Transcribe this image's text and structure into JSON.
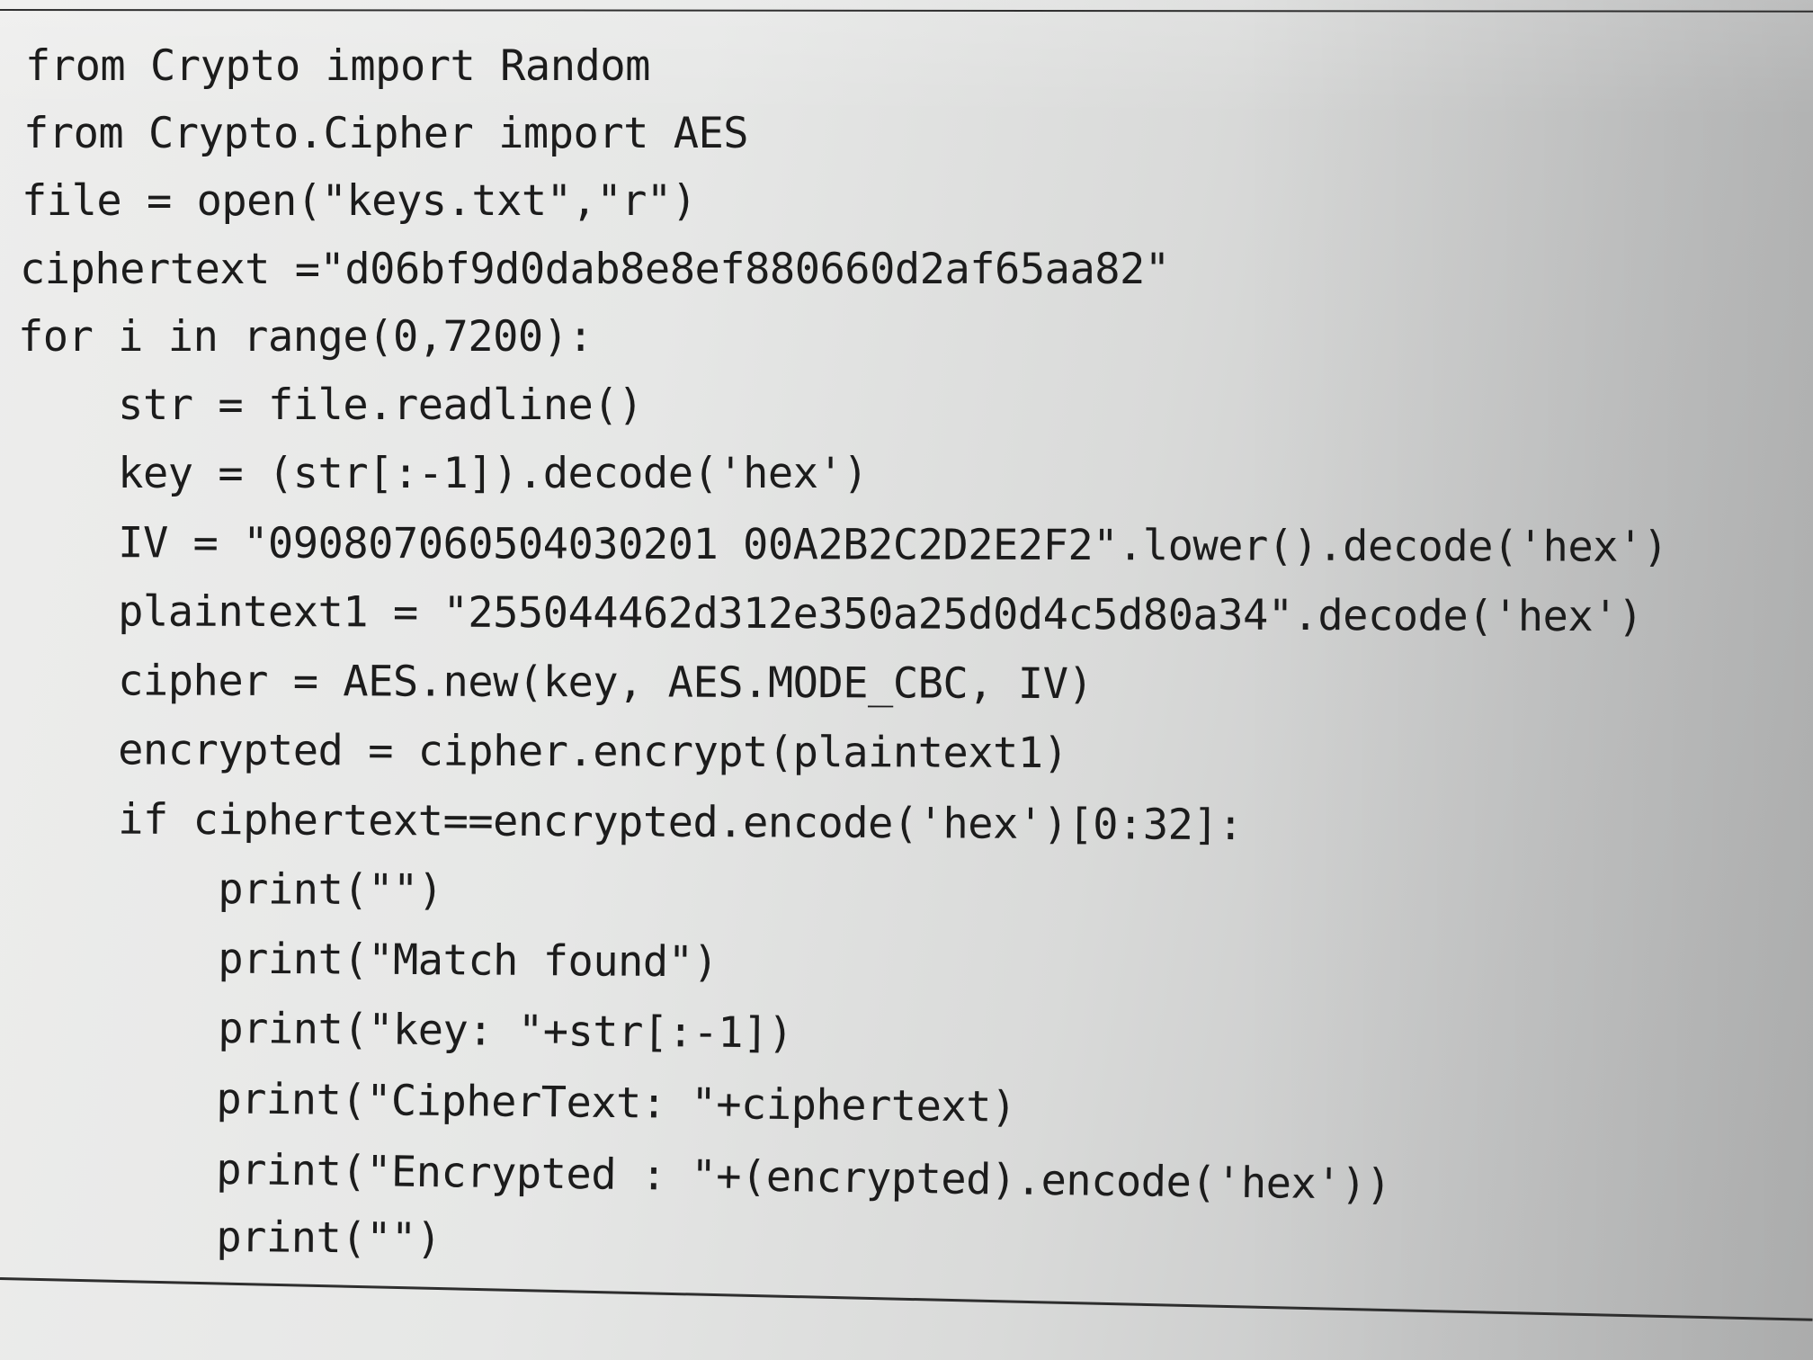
{
  "code": {
    "lines": [
      "from Crypto import Random",
      "from Crypto.Cipher import AES",
      "file = open(\"keys.txt\",\"r\")",
      "ciphertext =\"d06bf9d0dab8e8ef880660d2af65aa82\"",
      "for i in range(0,7200):",
      "    str = file.readline()",
      "    key = (str[:-1]).decode('hex')",
      "    IV = \"090807060504030201 00A2B2C2D2E2F2\".lower().decode('hex')",
      "    plaintext1 = \"255044462d312e350a25d0d4c5d80a34\".decode('hex')",
      "    cipher = AES.new(key, AES.MODE_CBC, IV)",
      "    encrypted = cipher.encrypt(plaintext1)",
      "    if ciphertext==encrypted.encode('hex')[0:32]:",
      "        print(\"\")",
      "        print(\"Match found\")",
      "        print(\"key: \"+str[:-1])",
      "        print(\"CipherText: \"+ciphertext)",
      "        print(\"Encrypted : \"+(encrypted).encode('hex'))",
      "        print(\"\")"
    ]
  }
}
